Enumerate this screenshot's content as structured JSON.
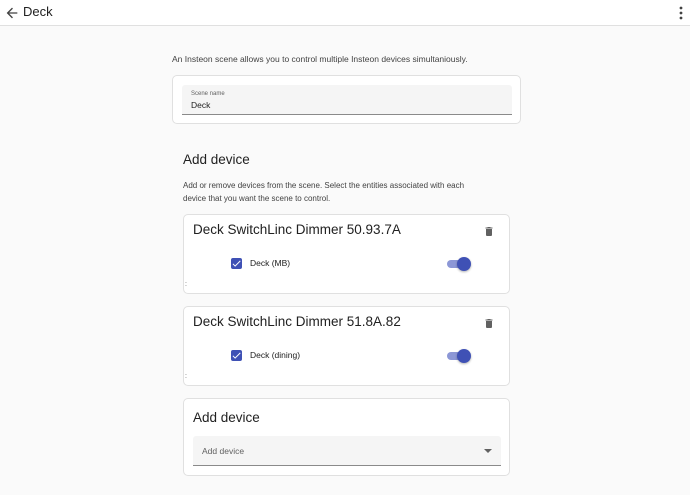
{
  "app": {
    "title": "Deck"
  },
  "intro": "An Insteon scene allows you to control multiple Insteon devices simultaniously.",
  "scene_name": {
    "label": "Scene name",
    "value": "Deck"
  },
  "add_device_section": {
    "heading": "Add device",
    "description": "Add or remove devices from the scene. Select the entities associated with each device that you want the scene to control."
  },
  "devices": [
    {
      "title": "Deck SwitchLinc Dimmer 50.93.7A",
      "entity_label": "Deck (MB)",
      "checked": true,
      "toggle_on": true,
      "stray": ":"
    },
    {
      "title": "Deck SwitchLinc Dimmer 51.8A.82",
      "entity_label": "Deck (dining)",
      "checked": true,
      "toggle_on": true,
      "stray": ":"
    }
  ],
  "add_device_card": {
    "title": "Add device",
    "select_placeholder": "Add device"
  },
  "icons": {
    "back": "arrow-left-icon",
    "more": "dots-vertical-icon",
    "delete": "trash-icon",
    "check": "check-icon",
    "dropdown": "caret-down-icon"
  },
  "colors": {
    "accent": "#3f51b5",
    "toggle_track": "#8c97d6",
    "background": "#fafafa",
    "card": "#ffffff",
    "field": "#f5f5f5"
  }
}
